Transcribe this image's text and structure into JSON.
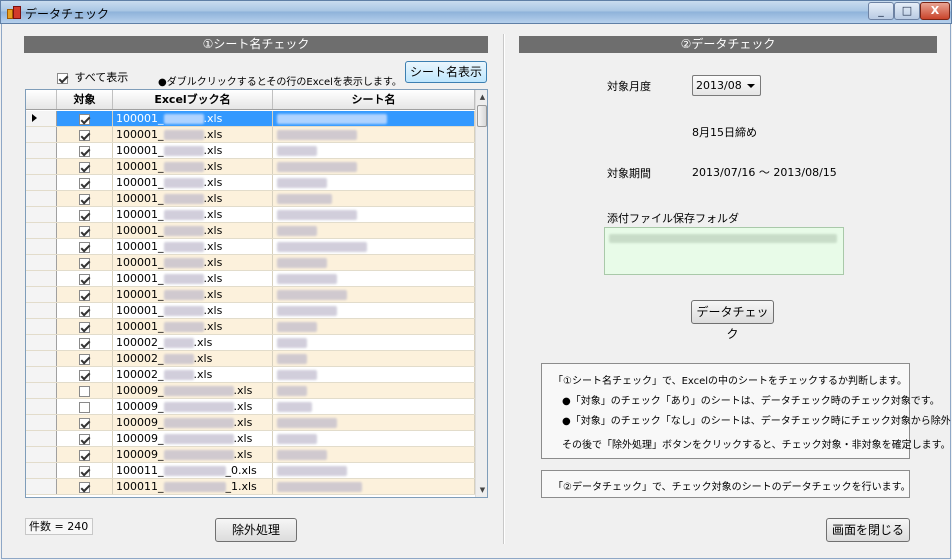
{
  "window": {
    "title": "データチェック",
    "min": "_",
    "max": "□",
    "close": "X"
  },
  "left": {
    "header": "①シート名チェック",
    "select_all_label": "すべて表示",
    "hint": "●ダブルクリックするとその行のExcelを表示します。",
    "show_sheet_button": "シート名表示",
    "columns": [
      "対象",
      "Excelブック名",
      "シート名"
    ],
    "rows": [
      {
        "checked": true,
        "prefix": "100001_",
        "suffix": ".xls"
      },
      {
        "checked": true,
        "prefix": "100001_",
        "suffix": ".xls"
      },
      {
        "checked": true,
        "prefix": "100001_",
        "suffix": ".xls"
      },
      {
        "checked": true,
        "prefix": "100001_",
        "suffix": ".xls"
      },
      {
        "checked": true,
        "prefix": "100001_",
        "suffix": ".xls"
      },
      {
        "checked": true,
        "prefix": "100001_",
        "suffix": ".xls"
      },
      {
        "checked": true,
        "prefix": "100001_",
        "suffix": ".xls"
      },
      {
        "checked": true,
        "prefix": "100001_",
        "suffix": ".xls"
      },
      {
        "checked": true,
        "prefix": "100001_",
        "suffix": ".xls"
      },
      {
        "checked": true,
        "prefix": "100001_",
        "suffix": ".xls"
      },
      {
        "checked": true,
        "prefix": "100001_",
        "suffix": ".xls"
      },
      {
        "checked": true,
        "prefix": "100001_",
        "suffix": ".xls"
      },
      {
        "checked": true,
        "prefix": "100001_",
        "suffix": ".xls"
      },
      {
        "checked": true,
        "prefix": "100001_",
        "suffix": ".xls"
      },
      {
        "checked": true,
        "prefix": "100002_",
        "suffix": ".xls"
      },
      {
        "checked": true,
        "prefix": "100002_",
        "suffix": ".xls"
      },
      {
        "checked": true,
        "prefix": "100002_",
        "suffix": ".xls"
      },
      {
        "checked": false,
        "prefix": "100009_",
        "suffix": ".xls"
      },
      {
        "checked": false,
        "prefix": "100009_",
        "suffix": ".xls"
      },
      {
        "checked": true,
        "prefix": "100009_",
        "suffix": ".xls"
      },
      {
        "checked": true,
        "prefix": "100009_",
        "suffix": ".xls"
      },
      {
        "checked": true,
        "prefix": "100009_",
        "suffix": ".xls"
      },
      {
        "checked": true,
        "prefix": "100011_",
        "suffix": "_0.xls"
      },
      {
        "checked": true,
        "prefix": "100011_",
        "suffix": "_1.xls"
      }
    ],
    "count_label": "件数 = 240",
    "exclude_button": "除外処理"
  },
  "right": {
    "header": "②データチェック",
    "month_label": "対象月度",
    "month_value": "2013/08",
    "closing_text": "8月15日締め",
    "period_label": "対象期間",
    "period_value": "2013/07/16 〜 2013/08/15",
    "folder_label": "添付ファイル保存フォルダ",
    "check_button": "データチェック",
    "info1": [
      "「①シート名チェック」で、Excelの中のシートをチェックするか判断します。",
      "●「対象」のチェック「あり」のシートは、データチェック時のチェック対象です。",
      "●「対象」のチェック「なし」のシートは、データチェック時にチェック対象から除外します。",
      "その後で「除外処理」ボタンをクリックすると、チェック対象・非対象を確定します。"
    ],
    "info2": "「②データチェック」で、チェック対象のシートのデータチェックを行います。",
    "close_button": "画面を閉じる"
  }
}
